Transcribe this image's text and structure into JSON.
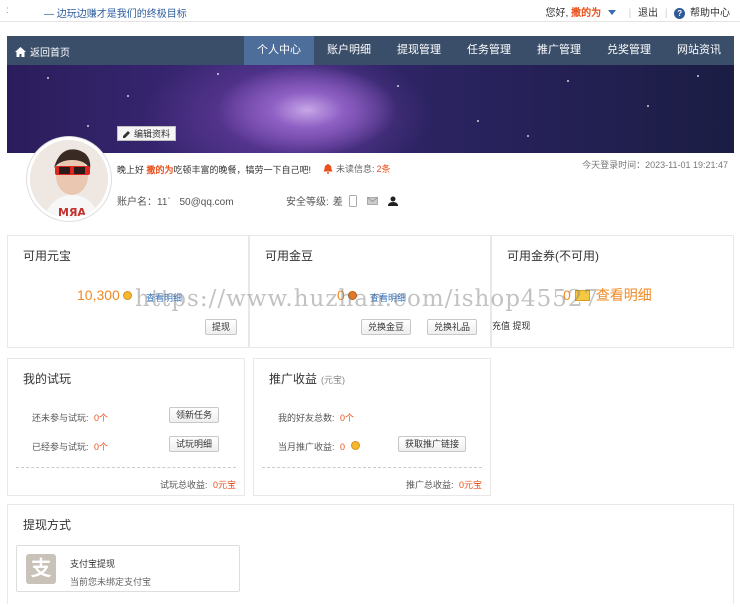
{
  "topbar": {
    "slogan": "— 边玩边赚才是我们的终极目标",
    "greeting": "您好,",
    "username": "撒的为",
    "logout": "退出",
    "help": "帮助中心"
  },
  "nav": {
    "home": "返回首页",
    "items": [
      "个人中心",
      "账户明细",
      "提现管理",
      "任务管理",
      "推广管理",
      "兑奖管理",
      "网站资讯"
    ],
    "active_index": 0
  },
  "profile": {
    "edit_label": "编辑资料",
    "greet_prefix": "晚上好",
    "greet_name": "撒的为",
    "greet_suffix": "吃顿丰富的晚餐，犒劳一下自己吧!",
    "unread_label": "未读信息:",
    "unread_count": "2条",
    "last_login": "今天登录时间：2023-11-01 19:21:47",
    "account_label": "账户名：11`",
    "account_value": "50@qq.com",
    "security_label": "安全等级:",
    "security_level": "差"
  },
  "cards": {
    "yuanbao": {
      "title": "可用元宝",
      "value": "10,300",
      "detail": "查看明细",
      "btn": "提现"
    },
    "jindou": {
      "title": "可用金豆",
      "value": "0",
      "detail": "查看明细",
      "btn1": "兑换金豆",
      "btn2": "兑换礼品"
    },
    "jinquan": {
      "title": "可用金券(不可用)",
      "value": "0",
      "detail": "查看明细",
      "links": "充值 提现"
    }
  },
  "trial": {
    "title": "我的试玩",
    "row1_label": "还未参与试玩:",
    "row1_value": "0个",
    "row1_btn": "领新任务",
    "row2_label": "已经参与试玩:",
    "row2_value": "0个",
    "row2_btn": "试玩明细",
    "total_label": "试玩总收益:",
    "total_value": "0元宝"
  },
  "promo": {
    "title": "推广收益",
    "unit": "(元宝)",
    "row1_label": "我的好友总数:",
    "row1_value": "0个",
    "row2_label": "当月推广收益:",
    "row2_value": "0",
    "row2_btn": "获取推广链接",
    "total_label": "推广总收益:",
    "total_value": "0元宝"
  },
  "withdraw": {
    "title": "提现方式",
    "method_icon": "支",
    "method_name": "支付宝提现",
    "method_status": "当前您未绑定支付宝"
  },
  "watermark": "https://www.huzhan.com/ishop45527"
}
